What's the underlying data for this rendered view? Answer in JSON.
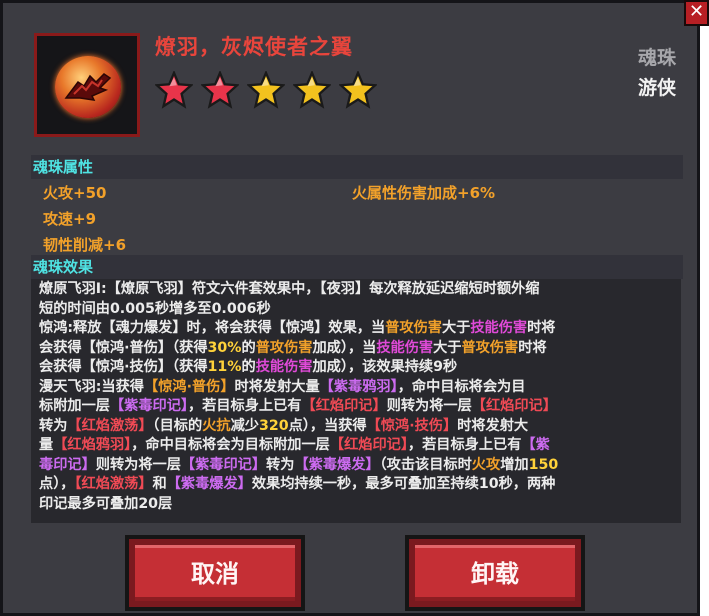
{
  "header": {
    "title": "燎羽，灰烬使者之翼",
    "type_label": "魂珠",
    "class_label": "游侠",
    "stars": [
      {
        "color": "#e8344a"
      },
      {
        "color": "#e8344a"
      },
      {
        "color": "#f3c21e"
      },
      {
        "color": "#f3c21e"
      },
      {
        "color": "#f3c21e"
      }
    ]
  },
  "attributes": {
    "section_title": "魂珠属性",
    "left": [
      "火攻+50",
      "攻速+9",
      "韧性削减+6"
    ],
    "right": [
      "火属性伤害加成+6%"
    ]
  },
  "effect": {
    "section_title": "魂珠效果",
    "lines": [
      [
        {
          "t": "燎原飞羽Ⅰ:【燎原飞羽】符文六件套效果中，【夜羽】每次释放延迟缩短时额外缩",
          "c": ""
        }
      ],
      [
        {
          "t": "短的时间由0.005秒增多至0.006秒",
          "c": ""
        }
      ],
      [
        {
          "t": "惊鸿:释放【魂力爆发】时，将会获得【惊鸿】效果，当",
          "c": ""
        },
        {
          "t": "普攻伤害",
          "c": "o"
        },
        {
          "t": "大于",
          "c": ""
        },
        {
          "t": "技能伤害",
          "c": "m"
        },
        {
          "t": "时将",
          "c": ""
        }
      ],
      [
        {
          "t": "会获得【惊鸿·普伤】（获得",
          "c": ""
        },
        {
          "t": "30%",
          "c": "y"
        },
        {
          "t": "的",
          "c": ""
        },
        {
          "t": "普攻伤害",
          "c": "o"
        },
        {
          "t": "加成），当",
          "c": ""
        },
        {
          "t": "技能伤害",
          "c": "m"
        },
        {
          "t": "大于",
          "c": ""
        },
        {
          "t": "普攻伤害",
          "c": "o"
        },
        {
          "t": "时将",
          "c": ""
        }
      ],
      [
        {
          "t": "会获得【惊鸿·技伤】（获得",
          "c": ""
        },
        {
          "t": "11%",
          "c": "y"
        },
        {
          "t": "的",
          "c": ""
        },
        {
          "t": "技能伤害",
          "c": "m"
        },
        {
          "t": "加成），该效果持续9秒",
          "c": ""
        }
      ],
      [
        {
          "t": "漫天飞羽:当获得",
          "c": ""
        },
        {
          "t": "【惊鸿·普伤】",
          "c": "o"
        },
        {
          "t": "时将发射大量",
          "c": ""
        },
        {
          "t": "【紫毒鸦羽】",
          "c": "p"
        },
        {
          "t": "，命中目标将会为目",
          "c": ""
        }
      ],
      [
        {
          "t": "标附加一层",
          "c": ""
        },
        {
          "t": "【紫毒印记】",
          "c": "p"
        },
        {
          "t": "，若目标身上已有",
          "c": ""
        },
        {
          "t": "【红焰印记】",
          "c": "r"
        },
        {
          "t": "则转为将一层",
          "c": ""
        },
        {
          "t": "【红焰印记】",
          "c": "r"
        }
      ],
      [
        {
          "t": "转为",
          "c": ""
        },
        {
          "t": "【红焰激荡】",
          "c": "r"
        },
        {
          "t": "（目标的",
          "c": ""
        },
        {
          "t": "火抗",
          "c": "o"
        },
        {
          "t": "减少",
          "c": ""
        },
        {
          "t": "320",
          "c": "y"
        },
        {
          "t": "点），当获得",
          "c": ""
        },
        {
          "t": "【惊鸿·技伤】",
          "c": "r"
        },
        {
          "t": "时将发射大",
          "c": ""
        }
      ],
      [
        {
          "t": "量",
          "c": ""
        },
        {
          "t": "【红焰鸦羽】",
          "c": "r"
        },
        {
          "t": "，命中目标将会为目标附加一层",
          "c": ""
        },
        {
          "t": "【红焰印记】",
          "c": "r"
        },
        {
          "t": "，若目标身上已有",
          "c": ""
        },
        {
          "t": "【紫",
          "c": "p"
        }
      ],
      [
        {
          "t": "毒印记】",
          "c": "p"
        },
        {
          "t": "则转为将一层",
          "c": ""
        },
        {
          "t": "【紫毒印记】",
          "c": "p"
        },
        {
          "t": "转为",
          "c": ""
        },
        {
          "t": "【紫毒爆发】",
          "c": "p"
        },
        {
          "t": "（攻击该目标时",
          "c": ""
        },
        {
          "t": "火攻",
          "c": "o"
        },
        {
          "t": "增加",
          "c": ""
        },
        {
          "t": "150",
          "c": "y"
        }
      ],
      [
        {
          "t": "点），",
          "c": ""
        },
        {
          "t": "【红焰激荡】",
          "c": "r"
        },
        {
          "t": "和",
          "c": ""
        },
        {
          "t": "【紫毒爆发】",
          "c": "p"
        },
        {
          "t": "效果均持续一秒，最多可叠加至持续10秒，两种",
          "c": ""
        }
      ],
      [
        {
          "t": "印记最多可叠加20层",
          "c": ""
        }
      ]
    ]
  },
  "buttons": {
    "cancel_label": "取消",
    "unload_label": "卸载"
  },
  "close_label": "✕"
}
